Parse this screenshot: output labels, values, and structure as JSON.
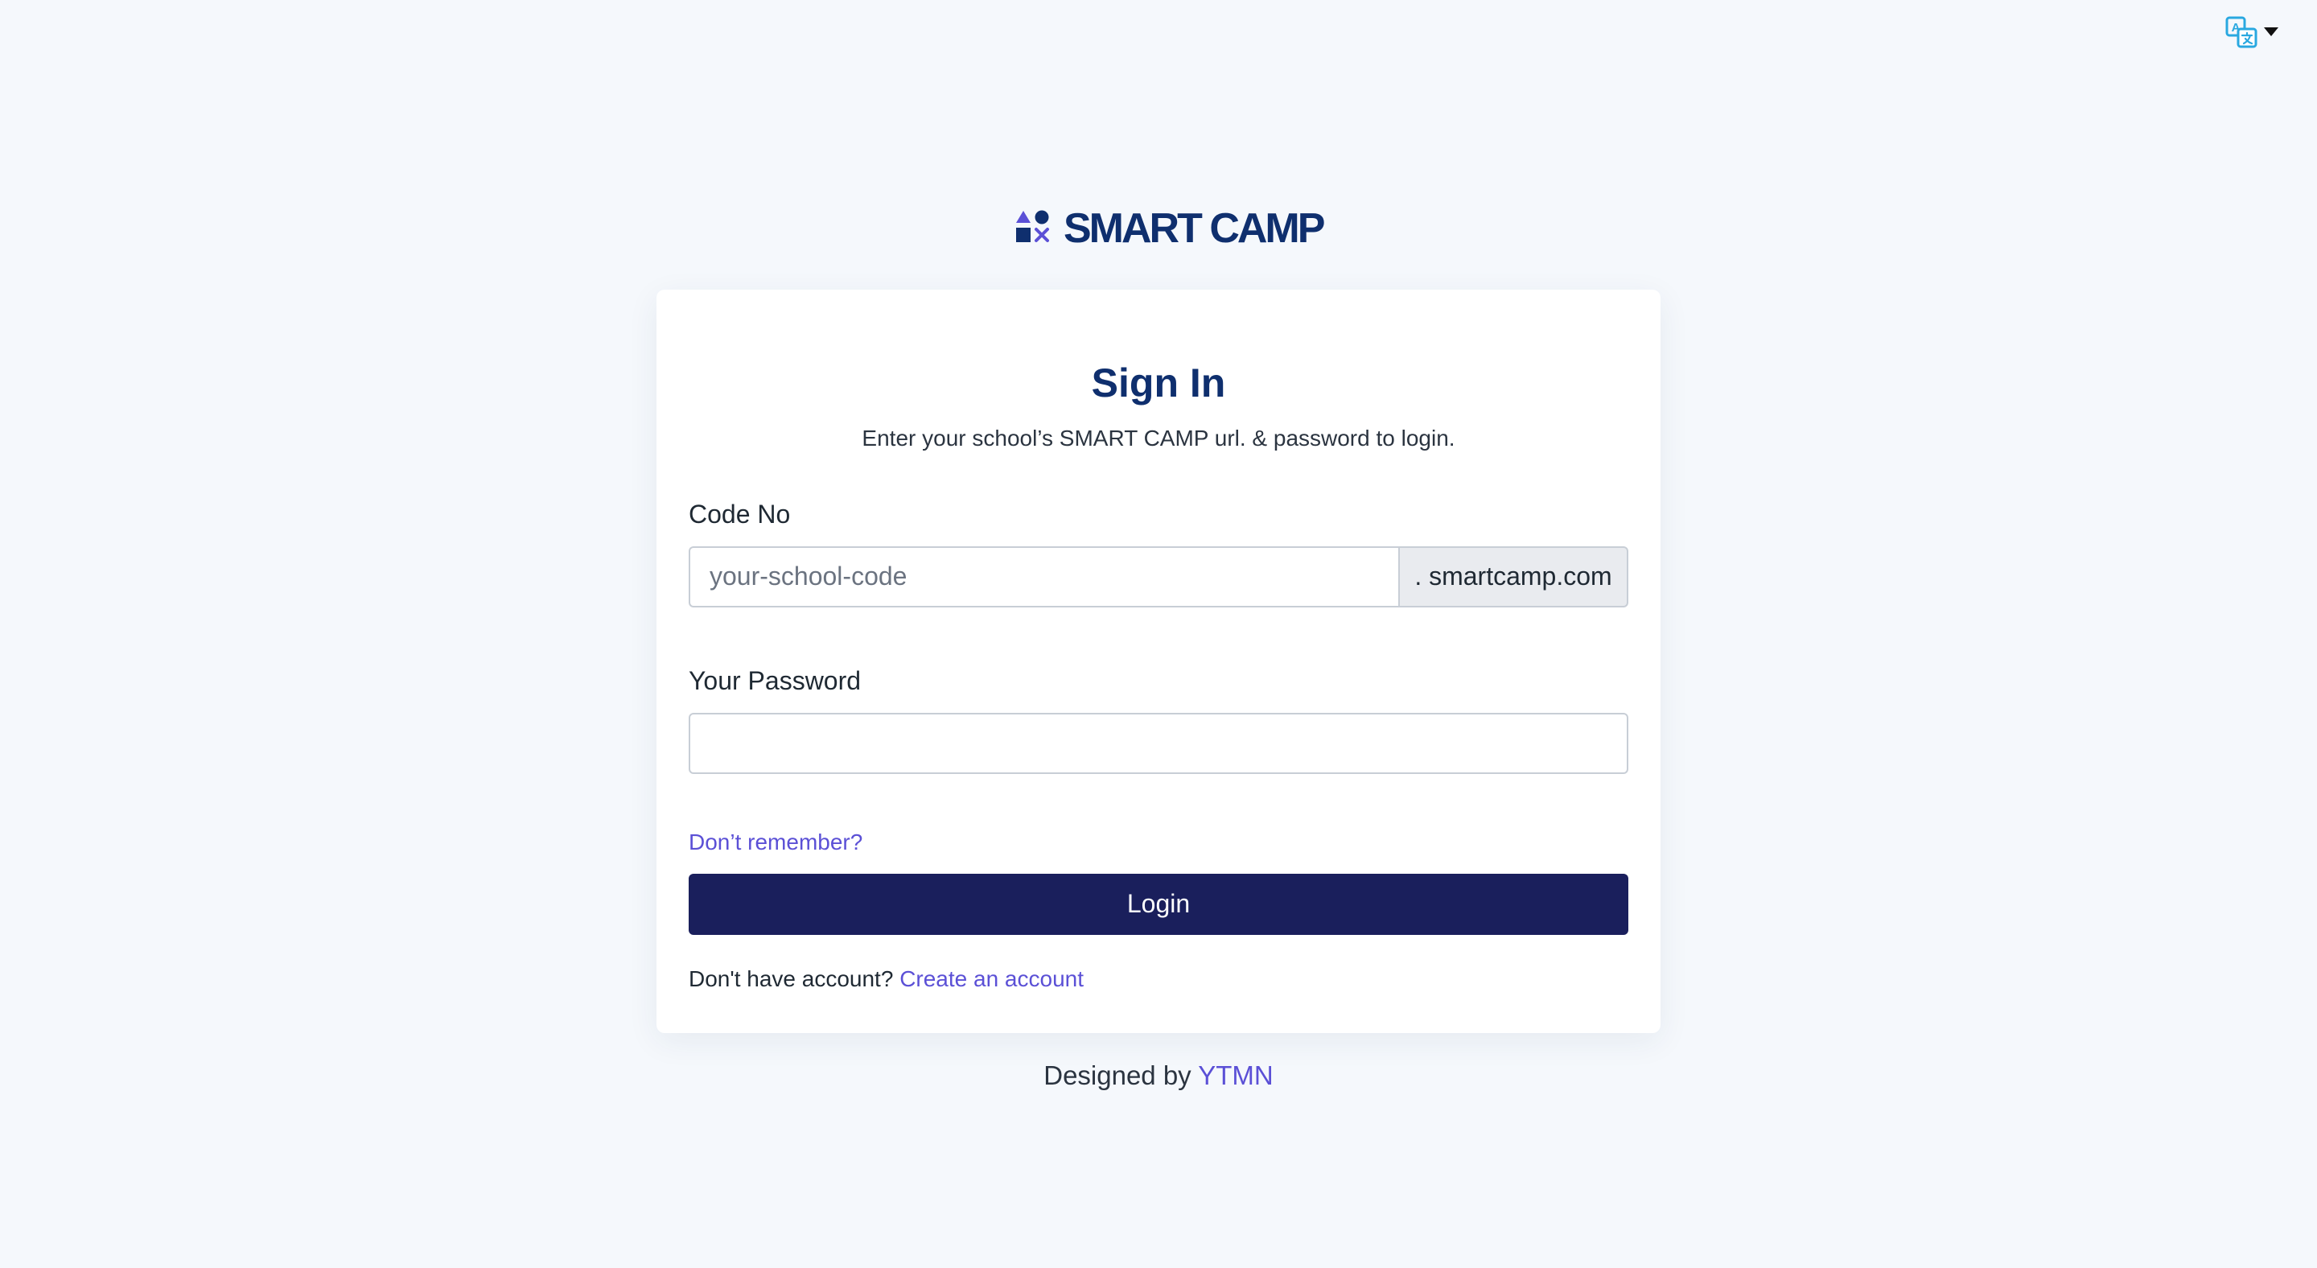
{
  "language_switcher": {
    "icon": "translate-icon",
    "caret_icon": "caret-down-icon"
  },
  "brand": {
    "name": "SMART CAMP",
    "logo_icon": "shapes-logo-icon"
  },
  "signin": {
    "title": "Sign In",
    "subtitle": "Enter your school’s SMART CAMP url. & password to login.",
    "code_label": "Code No",
    "code_placeholder": "your-school-code",
    "code_value": "",
    "code_suffix": ". smartcamp.com",
    "password_label": "Your Password",
    "password_value": "",
    "forgot_label": "Don’t remember?",
    "login_label": "Login",
    "no_account_text": "Don't have account?",
    "create_account_label": "Create an account"
  },
  "footer": {
    "designed_by": "Designed by",
    "author": "YTMN"
  },
  "colors": {
    "background": "#f5f8fc",
    "brand_navy": "#0f2f6e",
    "button": "#1a1f5c",
    "link": "#5b50d6",
    "accent_icon": "#29a8e0"
  }
}
